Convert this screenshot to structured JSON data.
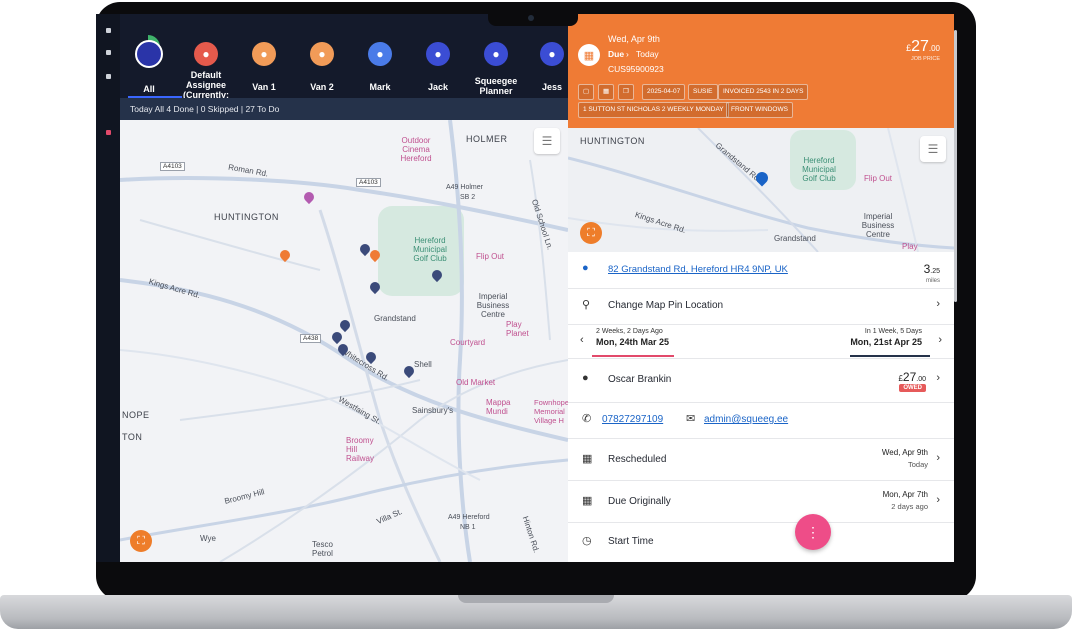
{
  "assignees": [
    {
      "name": "Default Assignee (Currently: Susie)",
      "color": "#e55a4c"
    },
    {
      "name": "Van 1",
      "color": "#f19b58"
    },
    {
      "name": "Van 2",
      "color": "#f19b58"
    },
    {
      "name": "Mark",
      "color": "#4a7be8"
    },
    {
      "name": "Jack",
      "color": "#3b4dd4"
    },
    {
      "name": "Squeegee Planner",
      "color": "#3b4dd4"
    },
    {
      "name": "Jess",
      "color": "#3b4dd4"
    }
  ],
  "all_label": "All",
  "status_summary": "Today All 4 Done | 0 Skipped | 27 To Do",
  "map": {
    "labels": [
      "HOLMER",
      "Roman Rd.",
      "HUNTINGTON",
      "Kings Acre Rd.",
      "Grandstand",
      "Whitecross Rd.",
      "Westfaing St.",
      "Broomy Hill",
      "Villa St.",
      "Wye",
      "Hinton Rd.",
      "Outdoor Cinema Hereford",
      "Hereford Municipal Golf Club",
      "Flip Out",
      "Imperial Business Centre",
      "Play Planet",
      "Courtyard",
      "Shell",
      "Old Market",
      "Mappa Mundi",
      "Sainsbury's",
      "Broomy Hill Railway",
      "Fownhope Memorial Village H",
      "Tesco Petrol",
      "Old School Ln.",
      "NOPE",
      "TON",
      "A49 Holmer",
      "SB 2",
      "A49 Hereford",
      "NB 1"
    ],
    "shields": [
      "A4103",
      "A4103",
      "A438"
    ]
  },
  "job": {
    "date": "Wed, Apr 9th",
    "due_label": "Due",
    "due_when": "Today",
    "customer_id": "CUS95900923",
    "price": "27",
    "price_decimal": ".00",
    "price_currency": "£",
    "price_caption": "JOB PRICE",
    "tags_row1": [
      "2025-04-07",
      "SUSIE",
      "INVOICED 2543 IN 2 DAYS"
    ],
    "tags_row2": [
      "1 SUTTON ST NICHOLAS 2 WEEKLY MONDAY",
      "FRONT WINDOWS"
    ]
  },
  "rmap": {
    "labels": [
      "HUNTINGTON",
      "Grandstand Rd.",
      "Kings Acre Rd.",
      "Grandstand",
      "Hereford Municipal Golf Club",
      "Flip Out",
      "Imperial Business Centre",
      "Play"
    ]
  },
  "address": "82 Grandstand Rd, Hereford HR4 9NP, UK",
  "distance": "3",
  "distance_decimal": ".25",
  "distance_unit": "miles",
  "change_pin": "Change Map Pin Location",
  "prev_visit": {
    "caption": "2 Weeks, 2 Days Ago",
    "date": "Mon, 24th Mar 25"
  },
  "next_visit": {
    "caption": "In 1 Week, 5 Days",
    "date": "Mon, 21st Apr 25"
  },
  "customer": {
    "name": "Oscar Brankin",
    "currency": "£",
    "amount": "27",
    "amount_decimal": ".00",
    "badge": "OWED"
  },
  "contact": {
    "phone": "07827297109",
    "email": "admin@squeeg.ee"
  },
  "rescheduled": {
    "label": "Rescheduled",
    "date": "Wed, Apr 9th",
    "sub": "Today"
  },
  "due_originally": {
    "label": "Due Originally",
    "date": "Mon, Apr 7th",
    "sub": "2 days ago"
  },
  "start_time": {
    "label": "Start Time"
  },
  "colors": {
    "header": "#ef7b35",
    "topbar": "#141a2b",
    "accent": "#1a64c7",
    "fab": "#ee4d88",
    "owed": "#e65a5a"
  }
}
